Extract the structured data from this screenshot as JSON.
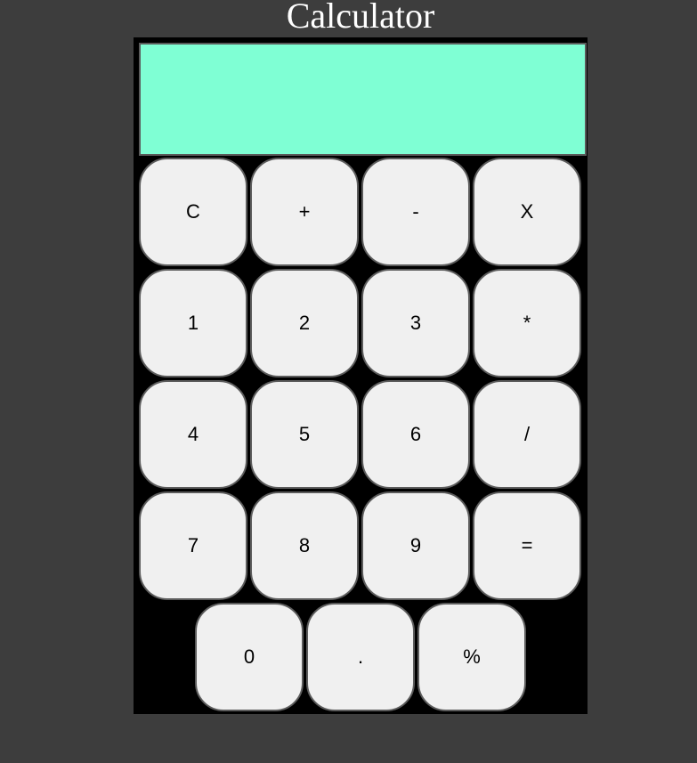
{
  "title": "Calculator",
  "display": {
    "value": ""
  },
  "colors": {
    "background": "#3d3d3d",
    "display": "#7fffd4",
    "button": "#f0f0f0",
    "panel": "#000000"
  },
  "rows": [
    [
      "C",
      "+",
      "-",
      "X"
    ],
    [
      "1",
      "2",
      "3",
      "*"
    ],
    [
      "4",
      "5",
      "6",
      "/"
    ],
    [
      "7",
      "8",
      "9",
      "="
    ],
    [
      "0",
      ".",
      "%"
    ]
  ]
}
